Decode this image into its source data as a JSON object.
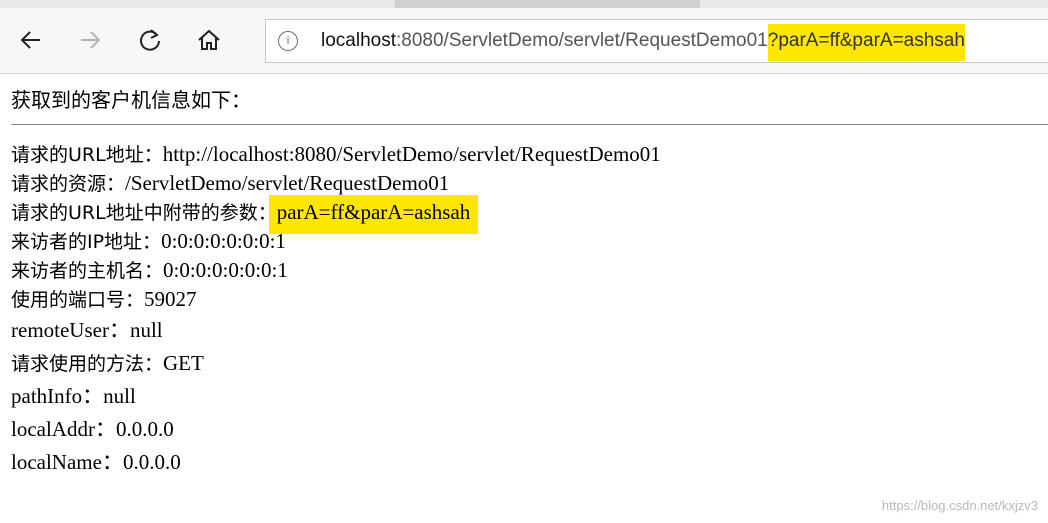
{
  "browser": {
    "url_host": "localhost",
    "url_path": ":8080/ServletDemo/servlet/RequestDemo01",
    "url_query": "?parA=ff&parA=ashsah",
    "icons": {
      "back": "back-arrow-icon",
      "forward": "forward-arrow-icon",
      "refresh": "refresh-icon",
      "home": "home-icon",
      "info": "info-icon"
    },
    "info_glyph": "i"
  },
  "page": {
    "heading": "获取到的客户机信息如下：",
    "rows": [
      {
        "label": "请求的URL地址：",
        "value": "http://localhost:8080/ServletDemo/servlet/RequestDemo01"
      },
      {
        "label": "请求的资源：",
        "value": "/ServletDemo/servlet/RequestDemo01"
      },
      {
        "label": "请求的URL地址中附带的参数：",
        "value": "parA=ff&parA=ashsah"
      },
      {
        "label": "来访者的IP地址：",
        "value": "0:0:0:0:0:0:0:1"
      },
      {
        "label": "来访者的主机名：",
        "value": "0:0:0:0:0:0:0:1"
      },
      {
        "label": "使用的端口号：",
        "value": "59027"
      },
      {
        "label": "remoteUser：",
        "value": "null"
      },
      {
        "label": "请求使用的方法：",
        "value": "GET"
      },
      {
        "label": "pathInfo：",
        "value": "null"
      },
      {
        "label": "localAddr：",
        "value": "0.0.0.0"
      },
      {
        "label": "localName：",
        "value": "0.0.0.0"
      }
    ],
    "highlight_color": "#ffe600"
  },
  "watermark": "https://blog.csdn.net/kxjzv3"
}
